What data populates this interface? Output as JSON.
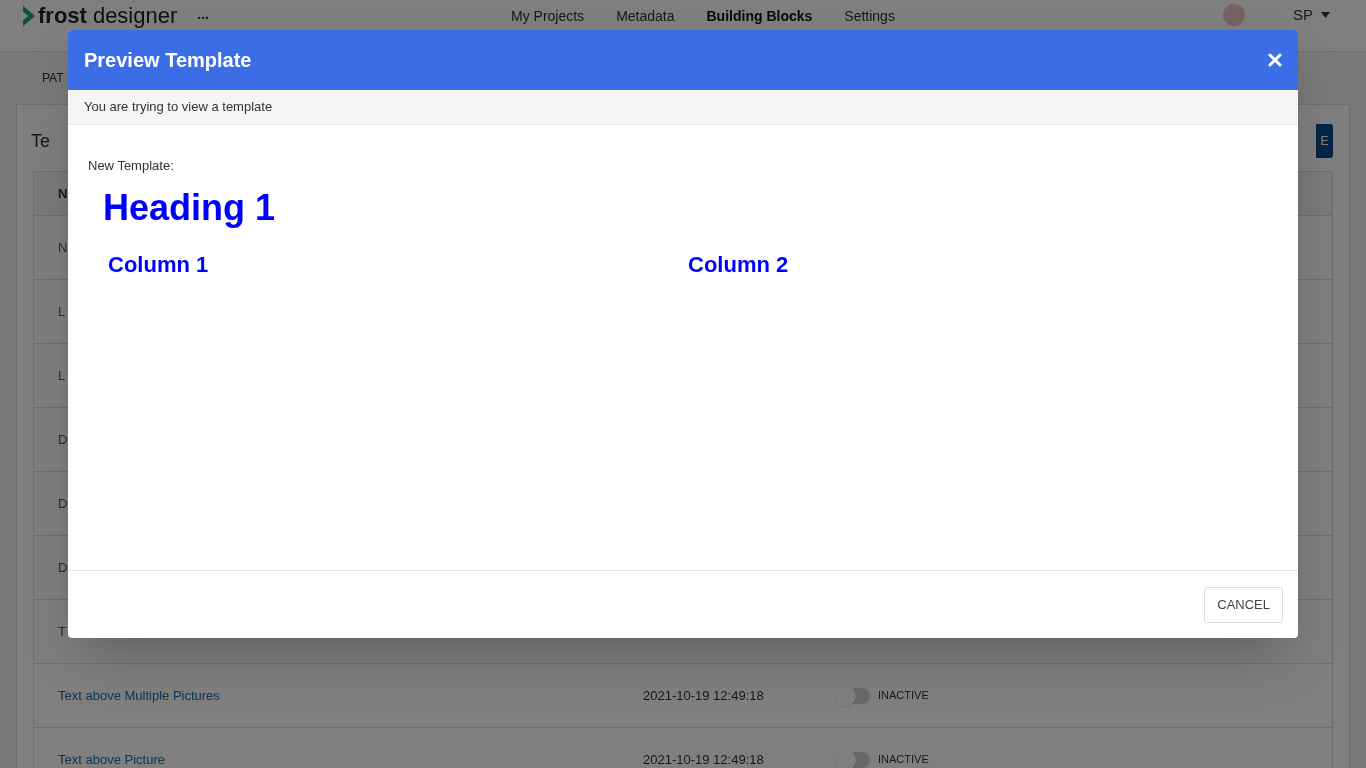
{
  "header": {
    "logo": {
      "part_1": "frost",
      "part_2": "designer"
    },
    "more": "...",
    "nav": [
      {
        "label": "My Projects",
        "selected": false
      },
      {
        "label": "Metadata",
        "selected": false
      },
      {
        "label": "Building Blocks",
        "selected": true
      },
      {
        "label": "Settings",
        "selected": false
      }
    ],
    "user": "SP"
  },
  "subnav": "PAT",
  "card": {
    "title": "Te",
    "button": "E",
    "table": {
      "columns": [
        "N"
      ],
      "rows": [
        {
          "name": "N"
        },
        {
          "name": "L"
        },
        {
          "name": "L"
        },
        {
          "name": "D"
        },
        {
          "name": "D"
        },
        {
          "name": "D"
        },
        {
          "name": "T"
        },
        {
          "name": "Text above Multiple Pictures",
          "date": "2021-10-19 12:49:18",
          "active": false,
          "status": "INACTIVE"
        },
        {
          "name": "Text above Picture",
          "date": "2021-10-19 12:49:18",
          "active": false,
          "status": "INACTIVE"
        }
      ]
    }
  },
  "modal": {
    "title": "Preview Template",
    "subtitle": "You are trying to view a template",
    "label": "New Template:",
    "heading": "Heading 1",
    "columns": [
      "Column 1",
      "Column 2"
    ],
    "cancel": "CANCEL"
  }
}
